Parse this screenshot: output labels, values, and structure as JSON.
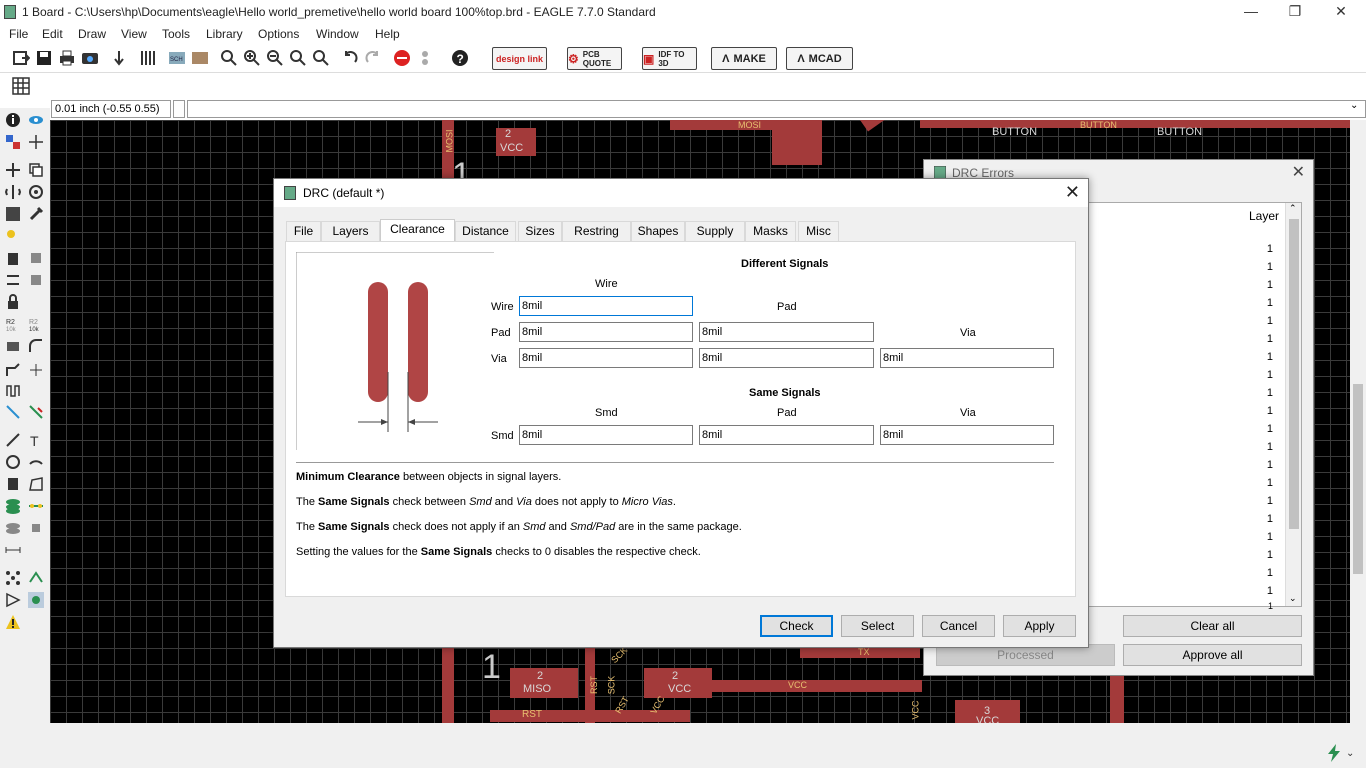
{
  "window": {
    "title": "1 Board - C:\\Users\\hp\\Documents\\eagle\\Hello world_premetive\\hello world board 100%top.brd - EAGLE 7.7.0 Standard",
    "minimize": "—",
    "restore": "❐",
    "close": "✕"
  },
  "menu": [
    "File",
    "Edit",
    "Draw",
    "View",
    "Tools",
    "Library",
    "Options",
    "Window",
    "Help"
  ],
  "toolbar": {
    "designlink": "design link",
    "pcbquote": "PCB QUOTE",
    "idf": "IDF TO 3D",
    "make": "MAKE",
    "mcad": "MCAD"
  },
  "coord": "0.01 inch (-0.55 0.55)",
  "pcb_labels": {
    "mosi_top": "MOSI",
    "mosi_side": "MOSI",
    "vcc_top": "VCC",
    "button1": "BUTTON",
    "button2": "BUTTON",
    "button3": "BUTTON",
    "miso": "MISO",
    "rst": "RST",
    "rst2": "RST",
    "rst3": "RST",
    "sck": "SCK",
    "sck2": "SCK",
    "vcc1": "VCC",
    "vcc2": "VCC",
    "vcc3": "VCC",
    "vcc4": "VCC",
    "vcc5": "VCC",
    "tx": "TX",
    "n1": "1",
    "n2": "2",
    "n3": "3",
    "n4": "2",
    "n5": "1",
    "n6": "2"
  },
  "drc_errors": {
    "title": "DRC Errors",
    "col_layer": "Layer",
    "rows": [
      "1",
      "1",
      "1",
      "1",
      "1",
      "1",
      "1",
      "1",
      "1",
      "1",
      "1",
      "1",
      "1",
      "1",
      "1",
      "1",
      "1",
      "1",
      "1",
      "1",
      "1",
      "1"
    ],
    "processed": "Processed",
    "clear_all": "Clear all",
    "approve_all": "Approve all"
  },
  "drc": {
    "title": "DRC (default *)",
    "tabs": [
      "File",
      "Layers",
      "Clearance",
      "Distance",
      "Sizes",
      "Restring",
      "Shapes",
      "Supply",
      "Masks",
      "Misc"
    ],
    "different_signals": "Different Signals",
    "same_signals": "Same Signals",
    "col_wire": "Wire",
    "col_pad": "Pad",
    "col_via": "Via",
    "col_smd": "Smd",
    "row_wire": "Wire",
    "row_pad": "Pad",
    "row_via": "Via",
    "row_smd": "Smd",
    "values": {
      "wire_wire": "8mil",
      "pad_wire": "8mil",
      "pad_pad": "8mil",
      "via_wire": "8mil",
      "via_pad": "8mil",
      "via_via": "8mil",
      "smd_smd": "8mil",
      "smd_pad": "8mil",
      "smd_via": "8mil"
    },
    "notes": {
      "n1_bold": "Minimum Clearance",
      "n1_rest": " between objects in signal layers.",
      "n2_a": "The ",
      "n2_bold": "Same Signals",
      "n2_b": " check between ",
      "n2_i1": "Smd",
      "n2_c": " and ",
      "n2_i2": "Via",
      "n2_d": " does not apply to ",
      "n2_i3": "Micro Vias",
      "n2_e": ".",
      "n3_a": "The ",
      "n3_bold": "Same Signals",
      "n3_b": " check does not apply if an ",
      "n3_i1": "Smd",
      "n3_c": " and ",
      "n3_i2": "Smd/Pad",
      "n3_d": " are in the same package.",
      "n4_a": "Setting the values for the ",
      "n4_bold": "Same Signals",
      "n4_b": " checks to 0 disables the respective check."
    },
    "buttons": {
      "check": "Check",
      "select": "Select",
      "cancel": "Cancel",
      "apply": "Apply"
    }
  }
}
